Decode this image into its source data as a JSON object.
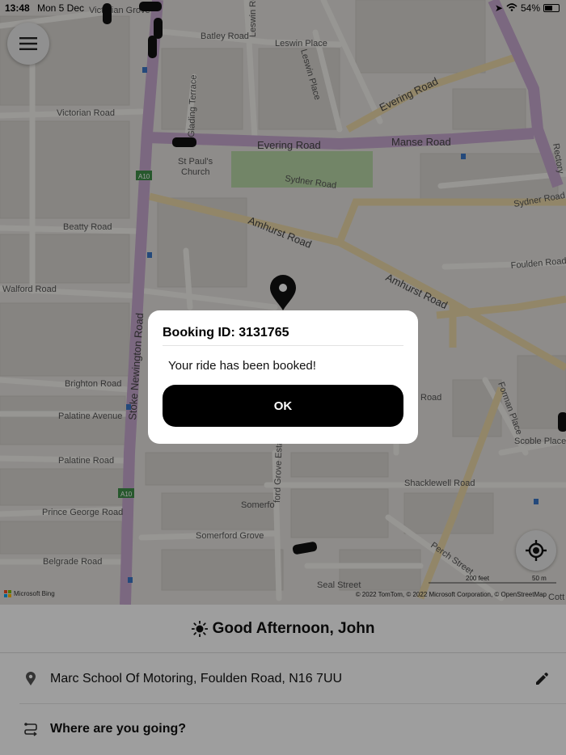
{
  "status_bar": {
    "time": "13:48",
    "date": "Mon 5 Dec",
    "battery": "54%",
    "battery_level": 0.54
  },
  "map": {
    "roads": {
      "victorian_grove": "Victorian Grove",
      "batley_road": "Batley Road",
      "leswin_road": "Leswin Road",
      "leswin_place": "Leswin Place",
      "evering_road_ne": "Evering Road",
      "victorian_road": "Victorian Road",
      "glading_terrace": "Glading Terrace",
      "evering_road": "Evering Road",
      "manse_road": "Manse Road",
      "rectory": "Rectory",
      "st_pauls_church": "St Paul's\nChurch",
      "sydner_road": "Sydner Road",
      "sydner_road_e": "Sydner Road",
      "a10_top": "A10",
      "a10_bottom": "A10",
      "beatty_road": "Beatty Road",
      "amhurst_road_1": "Amhurst Road",
      "amhurst_road_2": "Amhurst Road",
      "foulden_road": "Foulden Road",
      "walford_road": "Walford Road",
      "stoke_newington_road": "Stoke Newington Road",
      "brighton_road": "Brighton Road",
      "palatine_avenue": "Palatine Avenue",
      "palatine_road": "Palatine Road",
      "road_partial": "Road",
      "forman_place": "Forman Place",
      "scoble_place": "Scoble Place",
      "ford_grove_estate": "ford Grove Estate",
      "shacklewell_road": "Shacklewell Road",
      "prince_george_road": "Prince George Road",
      "somerford_partial": "Somerfo",
      "somerford_grove": "Somerford Grove",
      "perch_street": "Perch Street",
      "belgrade_road": "Belgrade Road",
      "seal_street": "Seal Street",
      "cotts_partial": "Cott"
    },
    "scale_feet": "200 feet",
    "scale_m": "50 m",
    "bing_label": "Microsoft Bing",
    "attribution": "© 2022 TomTom, © 2022 Microsoft Corporation, © OpenStreetMap"
  },
  "dialog": {
    "title": "Booking ID: 3131765",
    "message": "Your ride has been booked!",
    "ok_label": "OK"
  },
  "panel": {
    "greeting": "Good Afternoon, John",
    "pickup": "Marc School Of Motoring, Foulden Road, N16 7UU",
    "destination_placeholder": "Where are you going?"
  },
  "colors": {
    "major_road": "#c7a8cf",
    "secondary_road": "#ecd9a8",
    "park": "#b9d7a6",
    "button_black": "#000000"
  }
}
